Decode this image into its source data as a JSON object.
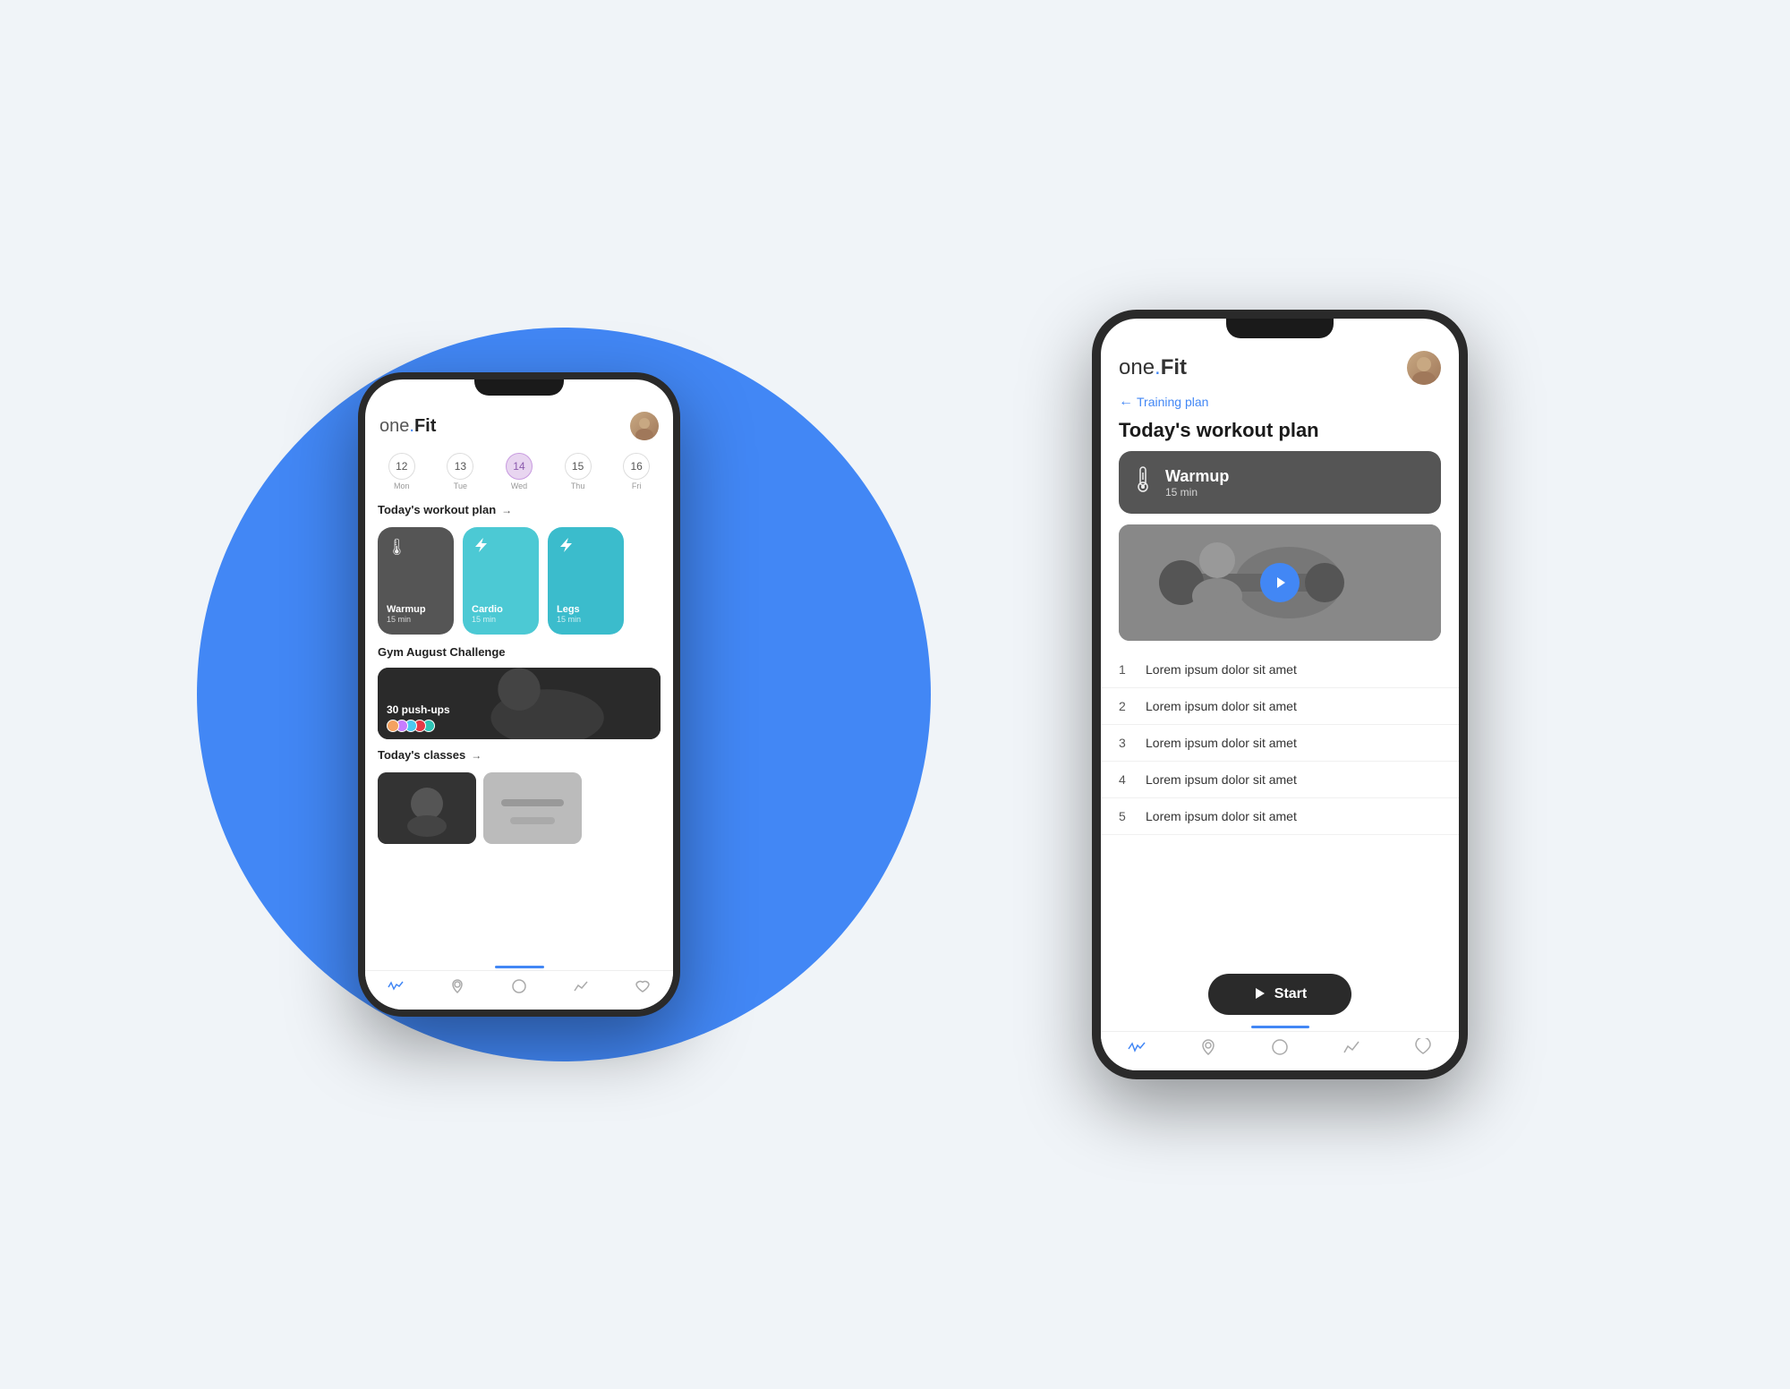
{
  "scene": {
    "bg_circle_color": "#4287f5"
  },
  "back_phone": {
    "logo": {
      "one": "one",
      "fit": "Fit",
      "dot_color": "#4287f5"
    },
    "calendar": {
      "days": [
        {
          "number": "12",
          "label": "Mon",
          "active": false
        },
        {
          "number": "13",
          "label": "Tue",
          "active": false
        },
        {
          "number": "14",
          "label": "Wed",
          "active": true
        },
        {
          "number": "15",
          "label": "Thu",
          "active": false
        },
        {
          "number": "16",
          "label": "Fri",
          "active": false
        }
      ]
    },
    "workout_section_title": "Today's workout plan",
    "workout_arrow": "→",
    "workout_cards": [
      {
        "name": "Warmup",
        "duration": "15 min",
        "color": "gray",
        "icon": "thermometer"
      },
      {
        "name": "Cardio",
        "duration": "15 min",
        "color": "cyan",
        "icon": "lightning"
      },
      {
        "name": "Legs",
        "duration": "15 min",
        "color": "cyan2",
        "icon": "lightning"
      }
    ],
    "challenge_section_title": "Gym August Challenge",
    "challenge_label": "30 push-ups",
    "classes_section_title": "Today's classes",
    "classes_arrow": "→",
    "bottom_nav": {
      "items": [
        "activity",
        "location",
        "home",
        "chart",
        "heart"
      ]
    }
  },
  "front_phone": {
    "logo": {
      "one": "one",
      "fit": "Fit",
      "dot_color": "#4287f5"
    },
    "back_link": "Training plan",
    "page_title": "Today's workout plan",
    "warmup": {
      "name": "Warmup",
      "duration": "15 min"
    },
    "exercise_list": [
      {
        "number": "1",
        "text": "Lorem ipsum dolor sit amet"
      },
      {
        "number": "2",
        "text": "Lorem ipsum dolor sit amet"
      },
      {
        "number": "3",
        "text": "Lorem ipsum dolor sit amet"
      },
      {
        "number": "4",
        "text": "Lorem ipsum dolor sit amet"
      },
      {
        "number": "5",
        "text": "Lorem ipsum dolor sit amet"
      }
    ],
    "start_button_label": "Start",
    "bottom_nav": {
      "items": [
        "activity",
        "location",
        "home",
        "chart",
        "heart"
      ]
    }
  }
}
